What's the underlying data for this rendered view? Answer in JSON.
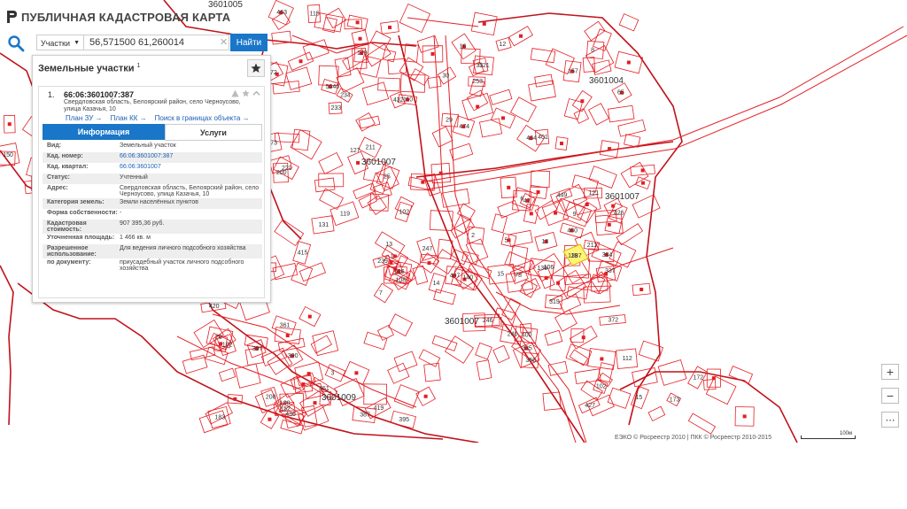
{
  "app": {
    "title": "ПУБЛИЧНАЯ КАДАСТРОВАЯ КАРТА"
  },
  "search": {
    "type_label": "Участки",
    "query": "56,571500 61,260014",
    "find_label": "Найти"
  },
  "panel": {
    "title": "Земельные участки",
    "count": "1",
    "card": {
      "index": "1.",
      "number": "66:06:3601007:387",
      "address": "Свердловская область, Белоярский район, село Черноусово, улица Казачья, 10",
      "links": {
        "plan_zu": "План ЗУ →",
        "plan_kk": "План КК →",
        "search_within": "Поиск в границах объекта →"
      },
      "tabs": {
        "info": "Информация",
        "services": "Услуги"
      },
      "attributes": [
        {
          "key": "Вид:",
          "value": "Земельный участок",
          "link": false
        },
        {
          "key": "Кад. номер:",
          "value": "66:06:3601007:387",
          "link": true
        },
        {
          "key": "Кад. квартал:",
          "value": "66:06:3601007",
          "link": true
        },
        {
          "key": "Статус:",
          "value": "Учтенный",
          "link": false
        },
        {
          "key": "Адрес:",
          "value": "Свердловская область, Белоярский район, село Черноусово, улица Казачья, 10",
          "link": false
        },
        {
          "key": "Категория земель:",
          "value": "Земли населённых пунктов",
          "link": false
        },
        {
          "key": "Форма собственности:",
          "value": "-",
          "link": false
        },
        {
          "key": "Кадастровая стоимость:",
          "value": "907 395,36 руб.",
          "link": false
        },
        {
          "key": "Уточненная площадь:",
          "value": "1 466 кв. м",
          "link": false
        },
        {
          "key": "Разрешенное использование:",
          "value": "Для ведения личного подсобного хозяйства",
          "link": false
        },
        {
          "key": "по документу:",
          "value": "приусадебный участок личного подсобного хозяйства",
          "link": false
        }
      ]
    }
  },
  "map": {
    "block_labels": [
      "3601005",
      "3601004",
      "3601007",
      "3601007",
      "3601007",
      "3601009"
    ],
    "parcel_labels": [
      "233",
      "234",
      "200",
      "5540",
      "472",
      "463",
      "473",
      "221",
      "211",
      "432",
      "115",
      "25",
      "29",
      "30",
      "110",
      "157",
      "33",
      "401",
      "474",
      "253",
      "16",
      "321",
      "8",
      "12",
      "65",
      "454",
      "460",
      "449",
      "9",
      "6",
      "121",
      "18",
      "119",
      "78",
      "5",
      "239",
      "247",
      "13",
      "14",
      "1",
      "108",
      "15",
      "7",
      "140",
      "166",
      "246",
      "240",
      "407",
      "2",
      "106",
      "47",
      "136",
      "372",
      "400",
      "356",
      "319",
      "335",
      "427",
      "426",
      "211",
      "384",
      "337",
      "361",
      "397",
      "420",
      "387",
      "419",
      "183",
      "182",
      "208",
      "70",
      "3",
      "390",
      "395",
      "190",
      "436",
      "451",
      "152",
      "179",
      "102",
      "112",
      "15",
      "173",
      "172",
      "150",
      "416",
      "415",
      "131",
      "102",
      "119"
    ],
    "special_labels": {
      "selected": "387",
      "sample": "127"
    },
    "colors": {
      "parcel": "#e31e24",
      "block": "#c0121a",
      "selected_fill": "#fff37a",
      "building": "#e31e24"
    }
  },
  "zoom": {
    "in": "+",
    "out": "−",
    "more": "⋯"
  },
  "attribution": "ЕЭКО © Росреестр 2010 | ПКК © Росреестр 2010-2015",
  "scale": "100м"
}
